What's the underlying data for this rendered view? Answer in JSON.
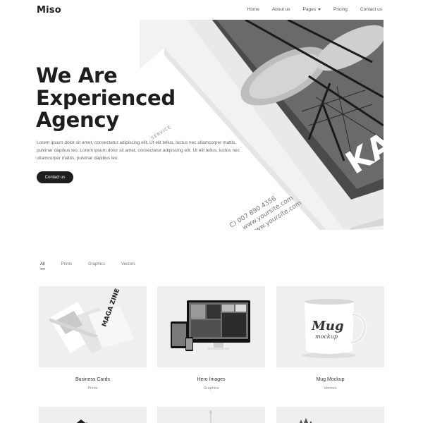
{
  "header": {
    "logo": "Miso",
    "nav": [
      {
        "label": "Home"
      },
      {
        "label": "About us"
      },
      {
        "label": "Pages"
      },
      {
        "label": "Pricing"
      },
      {
        "label": "Contact us"
      }
    ]
  },
  "hero": {
    "title_lines": [
      "We Are",
      "Experienced",
      "Agency"
    ],
    "description": "Lorem ipsum dolor sit amet, consectetur adipiscing elit. Ut elit tellus, luctus nec ullamcorper mattis, pulvinar dapibus leo. Lorem ipsum dolor sit amet, consectetur adipiscing elit. Ut elit tellus, luctus nec ullamcorper mattis, pulvinar dapibus leo.",
    "button": "Contact us",
    "card_text": {
      "service": "SERVICE",
      "phone": "C) 007 890 4356",
      "web1": "www.yoursite.com",
      "web2": "www.yoursite.com",
      "brand": "KA"
    }
  },
  "filters": [
    "All",
    "Prints",
    "Graphics",
    "Vectors"
  ],
  "portfolio": [
    {
      "title": "Business Cards",
      "category": "Prints",
      "image_text": "MAGA ZINE"
    },
    {
      "title": "Hero Images",
      "category": "Graphics"
    },
    {
      "title": "Mug Mockup",
      "category": "Vectors",
      "image_text": [
        "Mug",
        "mockup"
      ]
    }
  ]
}
